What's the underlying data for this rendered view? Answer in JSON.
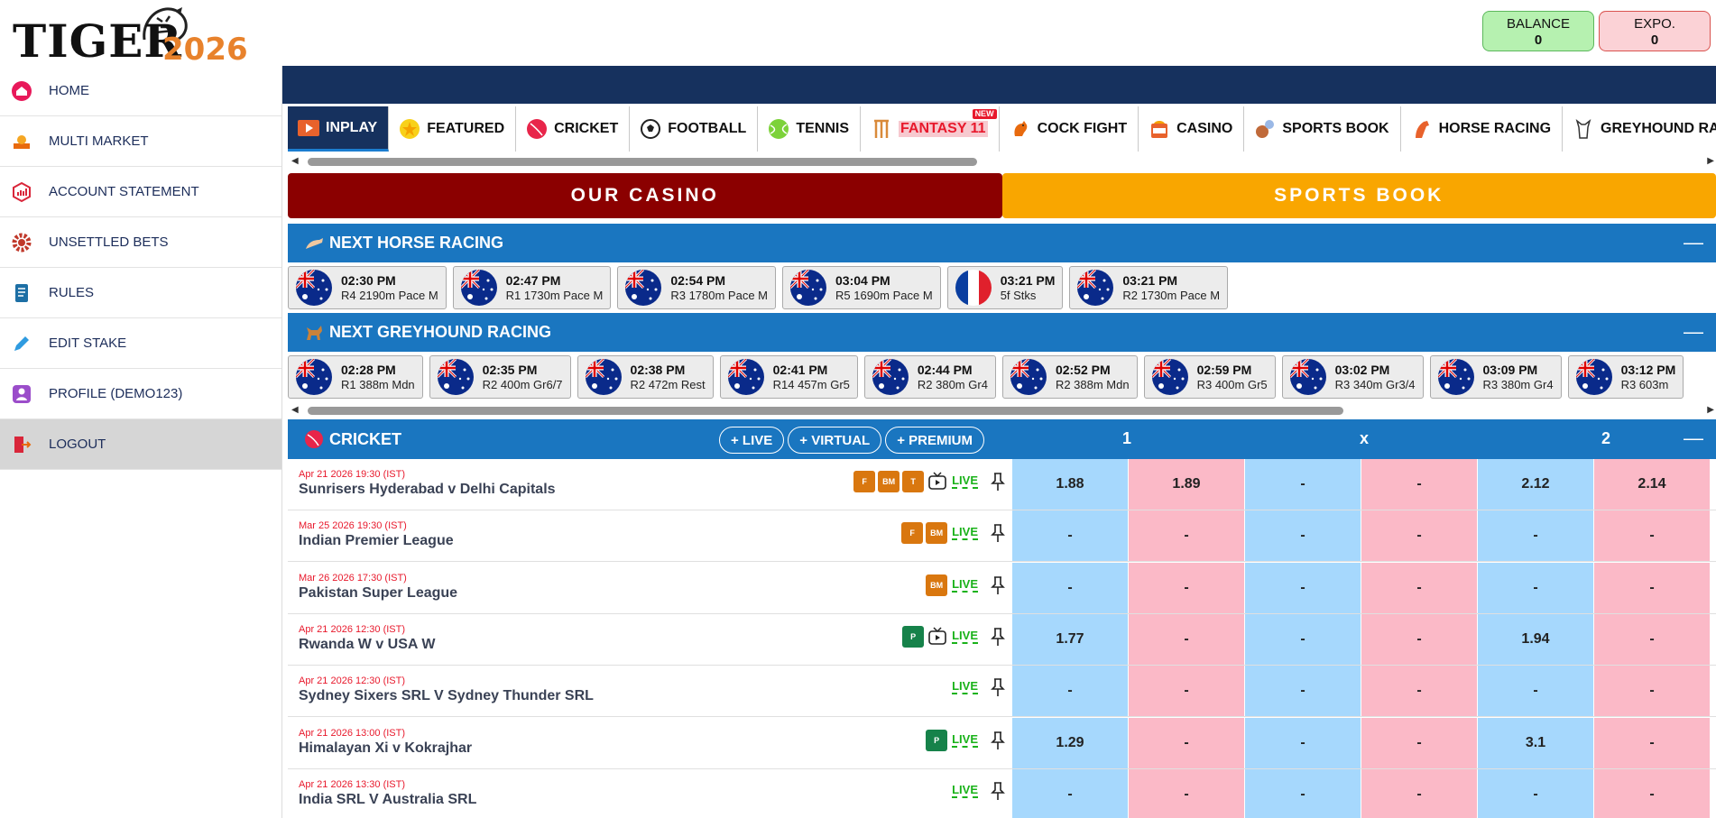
{
  "brand": {
    "name": "TIGER",
    "year": "2026"
  },
  "account": {
    "balance_label": "BALANCE",
    "balance_value": "0",
    "expo_label": "EXPO.",
    "expo_value": "0"
  },
  "sidebar": {
    "items": [
      {
        "label": "HOME",
        "icon": "home-icon"
      },
      {
        "label": "MULTI MARKET",
        "icon": "multi-market-icon"
      },
      {
        "label": "ACCOUNT STATEMENT",
        "icon": "statement-icon"
      },
      {
        "label": "UNSETTLED BETS",
        "icon": "gear-icon"
      },
      {
        "label": "RULES",
        "icon": "rules-icon"
      },
      {
        "label": "EDIT STAKE",
        "icon": "edit-icon"
      },
      {
        "label": "PROFILE (DEMO123)",
        "icon": "profile-icon"
      },
      {
        "label": "LOGOUT",
        "icon": "logout-icon"
      }
    ]
  },
  "tabs": [
    {
      "label": "INPLAY",
      "icon": "play-icon"
    },
    {
      "label": "FEATURED",
      "icon": "star-icon"
    },
    {
      "label": "CRICKET",
      "icon": "cricket-ball-icon"
    },
    {
      "label": "FOOTBALL",
      "icon": "football-icon"
    },
    {
      "label": "TENNIS",
      "icon": "tennis-ball-icon"
    },
    {
      "label": "FANTASY 11",
      "icon": "wicket-icon",
      "badge": "NEW"
    },
    {
      "label": "COCK FIGHT",
      "icon": "rooster-icon"
    },
    {
      "label": "CASINO",
      "icon": "casino-icon"
    },
    {
      "label": "SPORTS BOOK",
      "icon": "sportsbook-icon"
    },
    {
      "label": "HORSE RACING",
      "icon": "horse-icon"
    },
    {
      "label": "GREYHOUND RACING",
      "icon": "greyhound-icon"
    }
  ],
  "banners": {
    "casino": "OUR CASINO",
    "sports": "SPORTS BOOK"
  },
  "horse": {
    "title": "NEXT HORSE RACING",
    "races": [
      {
        "time": "02:30 PM",
        "desc": "R4 2190m Pace M",
        "flag": "au"
      },
      {
        "time": "02:47 PM",
        "desc": "R1 1730m Pace M",
        "flag": "au"
      },
      {
        "time": "02:54 PM",
        "desc": "R3 1780m Pace M",
        "flag": "au"
      },
      {
        "time": "03:04 PM",
        "desc": "R5 1690m Pace M",
        "flag": "au"
      },
      {
        "time": "03:21 PM",
        "desc": "5f Stks",
        "flag": "fr"
      },
      {
        "time": "03:21 PM",
        "desc": "R2 1730m Pace M",
        "flag": "au"
      }
    ]
  },
  "greyhound": {
    "title": "NEXT GREYHOUND RACING",
    "races": [
      {
        "time": "02:28 PM",
        "desc": "R1 388m Mdn"
      },
      {
        "time": "02:35 PM",
        "desc": "R2 400m Gr6/7"
      },
      {
        "time": "02:38 PM",
        "desc": "R2 472m Rest"
      },
      {
        "time": "02:41 PM",
        "desc": "R14 457m Gr5"
      },
      {
        "time": "02:44 PM",
        "desc": "R2 380m Gr4"
      },
      {
        "time": "02:52 PM",
        "desc": "R2 388m Mdn"
      },
      {
        "time": "02:59 PM",
        "desc": "R3 400m Gr5"
      },
      {
        "time": "03:02 PM",
        "desc": "R3 340m Gr3/4"
      },
      {
        "time": "03:09 PM",
        "desc": "R3 380m Gr4"
      },
      {
        "time": "03:12 PM",
        "desc": "R3 603m"
      }
    ]
  },
  "cricket": {
    "title": "CRICKET",
    "pills": [
      "+ LIVE",
      "+ VIRTUAL",
      "+ PREMIUM"
    ],
    "cols": [
      "1",
      "x",
      "2"
    ],
    "live_label": "LIVE",
    "matches": [
      {
        "date": "Apr 21 2026 19:30 (IST)",
        "name": "Sunrisers Hyderabad v Delhi Capitals",
        "badges": [
          "F",
          "BM",
          "T"
        ],
        "tv": true,
        "odds": [
          "1.88",
          "1.89",
          "-",
          "-",
          "2.12",
          "2.14"
        ]
      },
      {
        "date": "Mar 25 2026 19:30 (IST)",
        "name": "Indian Premier League",
        "badges": [
          "F",
          "BM"
        ],
        "tv": false,
        "odds": [
          "-",
          "-",
          "-",
          "-",
          "-",
          "-"
        ]
      },
      {
        "date": "Mar 26 2026 17:30 (IST)",
        "name": "Pakistan Super League",
        "badges": [
          "BM"
        ],
        "tv": false,
        "odds": [
          "-",
          "-",
          "-",
          "-",
          "-",
          "-"
        ]
      },
      {
        "date": "Apr 21 2026 12:30 (IST)",
        "name": "Rwanda W v USA W",
        "badges": [
          "P"
        ],
        "tv": true,
        "odds": [
          "1.77",
          "-",
          "-",
          "-",
          "1.94",
          "-"
        ]
      },
      {
        "date": "Apr 21 2026 12:30 (IST)",
        "name": "Sydney Sixers SRL V Sydney Thunder SRL",
        "badges": [],
        "tv": false,
        "odds": [
          "-",
          "-",
          "-",
          "-",
          "-",
          "-"
        ]
      },
      {
        "date": "Apr 21 2026 13:00 (IST)",
        "name": "Himalayan Xi v Kokrajhar",
        "badges": [
          "P"
        ],
        "tv": false,
        "odds": [
          "1.29",
          "-",
          "-",
          "-",
          "3.1",
          "-"
        ]
      },
      {
        "date": "Apr 21 2026 13:30 (IST)",
        "name": "India SRL V Australia SRL",
        "badges": [],
        "tv": false,
        "odds": [
          "-",
          "-",
          "-",
          "-",
          "-",
          "-"
        ]
      }
    ]
  }
}
